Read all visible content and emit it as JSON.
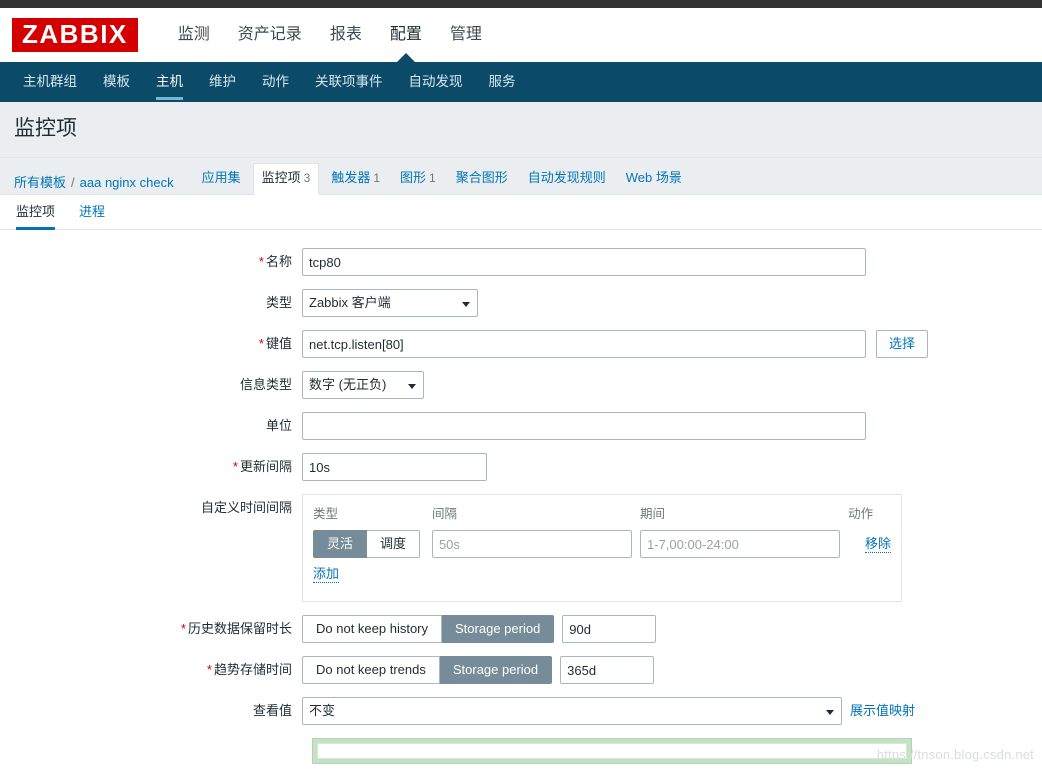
{
  "brand": {
    "logo_text": "ZABBIX",
    "logo_color": "#d40000"
  },
  "topnav": {
    "items": [
      {
        "label": "监测",
        "active": false
      },
      {
        "label": "资产记录",
        "active": false
      },
      {
        "label": "报表",
        "active": false
      },
      {
        "label": "配置",
        "active": true
      },
      {
        "label": "管理",
        "active": false
      }
    ]
  },
  "subnav": {
    "bg_color": "#0c4b68",
    "items": [
      {
        "label": "主机群组",
        "active": false
      },
      {
        "label": "模板",
        "active": false
      },
      {
        "label": "主机",
        "active": true
      },
      {
        "label": "维护",
        "active": false
      },
      {
        "label": "动作",
        "active": false
      },
      {
        "label": "关联项事件",
        "active": false
      },
      {
        "label": "自动发现",
        "active": false
      },
      {
        "label": "服务",
        "active": false
      }
    ]
  },
  "page": {
    "title": "监控项"
  },
  "breadcrumb": {
    "all_templates": "所有模板",
    "separator": "/",
    "host": "aaa nginx check",
    "tabs": [
      {
        "label": "应用集",
        "count": "",
        "active": false
      },
      {
        "label": "监控项",
        "count": "3",
        "active": true
      },
      {
        "label": "触发器",
        "count": "1",
        "active": false
      },
      {
        "label": "图形",
        "count": "1",
        "active": false
      },
      {
        "label": "聚合图形",
        "count": "",
        "active": false
      },
      {
        "label": "自动发现规则",
        "count": "",
        "active": false
      },
      {
        "label": "Web 场景",
        "count": "",
        "active": false
      }
    ]
  },
  "form_tabs": [
    {
      "label": "监控项",
      "active": true
    },
    {
      "label": "进程",
      "active": false
    }
  ],
  "form": {
    "name": {
      "label": "名称",
      "required": true,
      "value": "tcp80"
    },
    "type": {
      "label": "类型",
      "required": false,
      "value": "Zabbix 客户端"
    },
    "key": {
      "label": "键值",
      "required": true,
      "value": "net.tcp.listen[80]",
      "button": "选择"
    },
    "value_type": {
      "label": "信息类型",
      "required": false,
      "value": "数字 (无正负)"
    },
    "units": {
      "label": "单位",
      "required": false,
      "value": "",
      "placeholder": ""
    },
    "update_interval": {
      "label": "更新间隔",
      "required": true,
      "value": "10s"
    },
    "custom_intervals": {
      "label": "自定义时间间隔",
      "headers": {
        "type": "类型",
        "interval": "间隔",
        "period": "期间",
        "action": "动作"
      },
      "rows": [
        {
          "toggle": [
            {
              "label": "灵活",
              "selected": true
            },
            {
              "label": "调度",
              "selected": false
            }
          ],
          "interval_value": "",
          "interval_placeholder": "50s",
          "period_value": "",
          "period_placeholder": "1-7,00:00-24:00",
          "action_label": "移除"
        }
      ],
      "add_label": "添加"
    },
    "history": {
      "label": "历史数据保留时长",
      "required": true,
      "toggle": [
        {
          "label": "Do not keep history",
          "selected": false
        },
        {
          "label": "Storage period",
          "selected": true
        }
      ],
      "value": "90d"
    },
    "trends": {
      "label": "趋势存储时间",
      "required": true,
      "toggle": [
        {
          "label": "Do not keep trends",
          "selected": false
        },
        {
          "label": "Storage period",
          "selected": true
        }
      ],
      "value": "365d"
    },
    "value_map": {
      "label": "查看值",
      "required": false,
      "value": "不变",
      "link": "展示值映射"
    }
  },
  "watermark": {
    "text": "https://tnson.blog.csdn.net"
  },
  "colors": {
    "accent_link": "#0275b8",
    "subnav_bg": "#0c4b68",
    "toggle_selected": "#768d99",
    "required_star": "#d40000",
    "title_band": "#ebeef0"
  }
}
